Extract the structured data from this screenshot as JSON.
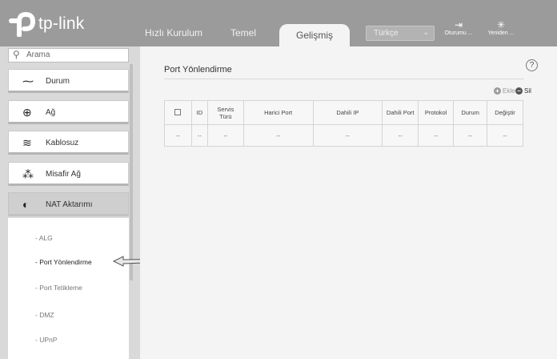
{
  "brand": {
    "name": "tp-link"
  },
  "nav": {
    "tabs": [
      {
        "label": "Hızlı Kurulum"
      },
      {
        "label": "Temel"
      },
      {
        "label": "Gelişmiş"
      }
    ],
    "active_tab": "Gelişmiş"
  },
  "language": {
    "selected": "Türkçe"
  },
  "header_buttons": {
    "logout_label": "Oturumu ...",
    "reboot_label": "Yeniden ..."
  },
  "search": {
    "placeholder": "Arama"
  },
  "sidebar": {
    "items": [
      {
        "label": "Durum",
        "icon": "pulse-icon"
      },
      {
        "label": "Ağ",
        "icon": "globe-icon"
      },
      {
        "label": "Kablosuz",
        "icon": "wifi-icon"
      },
      {
        "label": "Misafir Ağ",
        "icon": "guests-icon"
      },
      {
        "label": "NAT Aktarımı",
        "icon": "nat-icon"
      }
    ],
    "submenu": [
      {
        "label": "- ALG"
      },
      {
        "label": "- Port Yönlendirme"
      },
      {
        "label": "- Port Tetikleme"
      },
      {
        "label": "- DMZ"
      },
      {
        "label": "- UPnP"
      }
    ]
  },
  "panel": {
    "title": "Port Yönlendirme",
    "add_label": "Ekle",
    "delete_label": "Sil"
  },
  "table": {
    "headers": [
      "ID",
      "Servis\nTürü",
      "Harici Port",
      "Dahili IP",
      "Dahili Port",
      "Protokol",
      "Durum",
      "Değiştir"
    ],
    "row": [
      "--",
      "--",
      "--",
      "--",
      "--",
      "--",
      "--",
      "--",
      "--"
    ]
  },
  "colors": {
    "header_bg": "#9b9b9b",
    "sidebar_bg": "#d9d9d9",
    "panel_bg": "#f4f4f4"
  }
}
